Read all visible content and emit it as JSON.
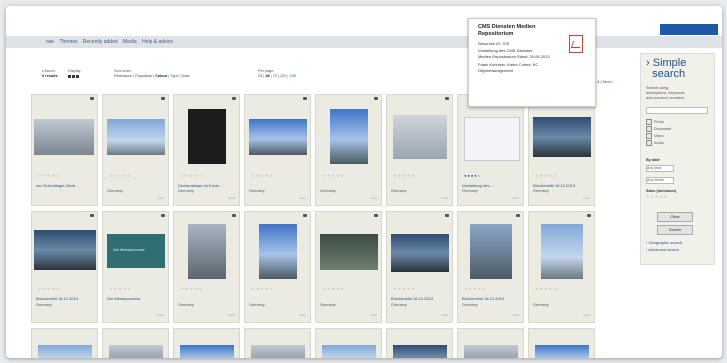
{
  "nav": {
    "items": [
      "ose",
      "Themes",
      "Recently added",
      "Media",
      "Help & advice"
    ]
  },
  "controls": {
    "found_label": "s found:",
    "found_value": "6 results",
    "display_label": "Display:",
    "sort_label": "Sort order:",
    "sort_options": [
      "Relevance",
      "Popularity",
      "Colour",
      "Type",
      "Date"
    ],
    "sort_selected": "Colour",
    "per_page_label": "Per page:",
    "per_page_options": [
      "24",
      "48",
      "72",
      "120",
      "240"
    ],
    "per_page_selected": "48"
  },
  "pager": {
    "text": "e 5 of 4",
    "next": "Next ›"
  },
  "tooltip": {
    "title_line1": "CMS Diensten Medien",
    "title_line2": "Repositorium",
    "resource_id": "Resource ID: 375",
    "desc1": "Vorstellung des CMS-Dienstes",
    "desc2": "Medien Repositorium Stand: 20.06.2013",
    "authors": "Frank Kuhnlein, Karim Cortes, KC",
    "category": "Objektmanagement"
  },
  "sidebar": {
    "heading1": "Simple",
    "heading2": "search",
    "hint1": "Search using",
    "hint2": "descriptions, keywords",
    "hint3": "and resource numbers",
    "checkboxes": [
      "Photo",
      "Document",
      "Video",
      "Audio"
    ],
    "by_date": "By date",
    "any_year": "Any year",
    "any_month": "Any month",
    "stars_label": "Stars (minimum)",
    "clear": "Clear",
    "search": "Search",
    "geo_link": "› Geographic search",
    "adv_link": "› Advanced search"
  },
  "tiles_row1": [
    {
      "title": "ner-Schrödinger-Zentr",
      "loc": ""
    },
    {
      "title": "",
      "loc": "Germany"
    },
    {
      "title": "Deckenlampe im Erwin...",
      "loc": "Germany"
    },
    {
      "title": "",
      "loc": "Germany"
    },
    {
      "title": "",
      "loc": "Germany"
    },
    {
      "title": "",
      "loc": "Germany"
    },
    {
      "title": "Vorstellung des...",
      "loc": "Germany"
    },
    {
      "title": "Brückenbild 16.12.2013",
      "loc": "Germany"
    }
  ],
  "tiles_row2": [
    {
      "title": "Brückenbild 16.12.2013",
      "loc": "Germany"
    },
    {
      "title": "Der Messeprozess",
      "loc": ""
    },
    {
      "title": "",
      "loc": "Germany"
    },
    {
      "title": "",
      "loc": "Germany"
    },
    {
      "title": "",
      "loc": "Germany"
    },
    {
      "title": "Brückenbild 16.12.2013",
      "loc": "Germany"
    },
    {
      "title": "Brückenbild 16.12.2013",
      "loc": "Germany"
    },
    {
      "title": "",
      "loc": "Germany"
    }
  ],
  "thumb_text": "Der Messeprozess",
  "colors": {
    "link": "#1d4f8c",
    "nav_bg": "#dfe3e7",
    "tile_bg": "#ecebe2",
    "accent": "#1f5aa8"
  }
}
